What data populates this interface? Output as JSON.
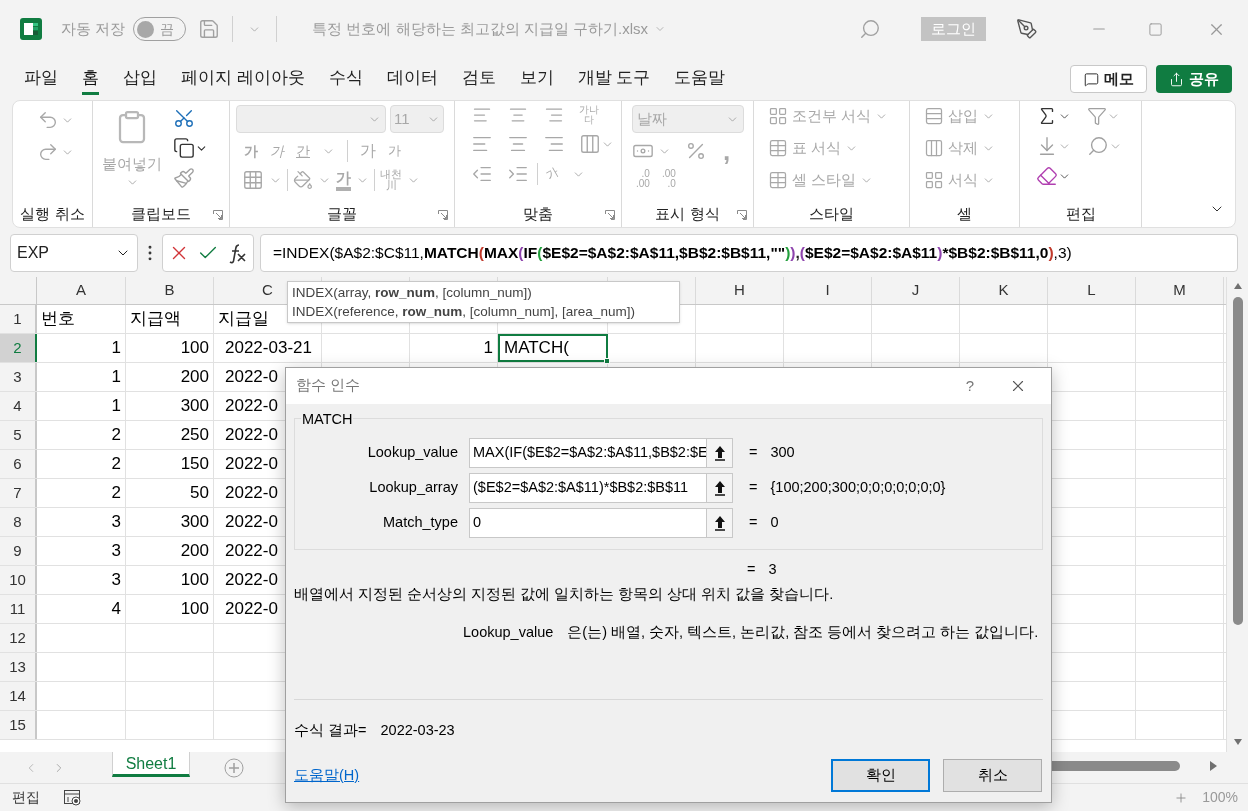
{
  "title_bar": {
    "autosave_label": "자동 저장",
    "autosave": {
      "on": false,
      "label": "끔"
    },
    "filename": "특정 번호에 해당하는 최고값의 지급일 구하기.xlsx",
    "login": "로그인"
  },
  "menu": {
    "tabs": [
      {
        "label": "파일",
        "selected": false
      },
      {
        "label": "홈",
        "selected": true
      },
      {
        "label": "삽입",
        "selected": false
      },
      {
        "label": "페이지 레이아웃",
        "selected": false
      },
      {
        "label": "수식",
        "selected": false
      },
      {
        "label": "데이터",
        "selected": false
      },
      {
        "label": "검토",
        "selected": false
      },
      {
        "label": "보기",
        "selected": false
      },
      {
        "label": "개발 도구",
        "selected": false
      },
      {
        "label": "도움말",
        "selected": false
      }
    ],
    "memo": "메모",
    "share": "공유"
  },
  "ribbon": {
    "disabled": true,
    "groups": [
      {
        "kind": "undo",
        "label": "실행 취소",
        "launcher": false
      },
      {
        "kind": "clipboard",
        "label": "클립보드",
        "launcher": true,
        "paste": "붙여넣기"
      },
      {
        "kind": "font",
        "label": "글꼴",
        "launcher": true,
        "font_size": "11",
        "bold": "가",
        "italic": "가",
        "underline": "간",
        "grow": "가",
        "shrink": "가",
        "font_color": "가",
        "phonetic": [
          "내천",
          "川"
        ]
      },
      {
        "kind": "alignment",
        "label": "맞춤",
        "launcher": true,
        "wrap": [
          "가나",
          "다"
        ],
        "orientation": "가"
      },
      {
        "kind": "number",
        "label": "표시 형식",
        "launcher": true,
        "format": "날짜",
        "comma": ",",
        "decimals": [
          [
            ".0",
            ".00"
          ],
          [
            ".00",
            ".0"
          ]
        ]
      },
      {
        "kind": "styles",
        "label": "스타일",
        "launcher": false,
        "items": [
          "조건부 서식",
          "표 서식",
          "셀 스타일"
        ]
      },
      {
        "kind": "cells",
        "label": "셀",
        "launcher": false,
        "items": [
          "삽입",
          "삭제",
          "서식"
        ]
      },
      {
        "kind": "editing",
        "label": "편집",
        "launcher": false
      }
    ]
  },
  "formula_bar": {
    "name_box": "EXP",
    "segments": [
      {
        "text": "=INDEX($A$2:$C$11,",
        "bold": false,
        "color": "#000000"
      },
      {
        "text": "MATCH",
        "bold": true,
        "color": "#000000"
      },
      {
        "text": "(",
        "bold": true,
        "color": "#c0392b"
      },
      {
        "text": "MAX",
        "bold": true,
        "color": "#000000"
      },
      {
        "text": "(",
        "bold": true,
        "color": "#8e44ad"
      },
      {
        "text": "IF",
        "bold": true,
        "color": "#000000"
      },
      {
        "text": "(",
        "bold": true,
        "color": "#22a03c"
      },
      {
        "text": "$E$2=$A$2:$A$11,$B$2:$B$11,\"\"",
        "bold": true,
        "color": "#000000"
      },
      {
        "text": ")",
        "bold": true,
        "color": "#22a03c"
      },
      {
        "text": ")",
        "bold": true,
        "color": "#8e44ad"
      },
      {
        "text": ",",
        "bold": true
      },
      {
        "text": "(",
        "bold": true,
        "color": "#8e44ad"
      },
      {
        "text": "$E$2=$A$2:$A$11",
        "bold": true,
        "color": "#000000"
      },
      {
        "text": ")",
        "bold": true,
        "color": "#8e44ad"
      },
      {
        "text": "*$B$2:$B$11,0",
        "bold": true,
        "color": "#000000"
      },
      {
        "text": ")",
        "bold": true,
        "color": "#c0392b"
      },
      {
        "text": ",3)",
        "bold": false,
        "color": "#000000"
      }
    ]
  },
  "tooltip": {
    "lines": [
      "INDEX(array, **row_num**, [column_num])",
      "INDEX(reference, **row_num**, [column_num], [area_num])"
    ]
  },
  "column_headers": [
    {
      "kind": "letter",
      "label": "A"
    },
    {
      "kind": "letter",
      "label": "B"
    },
    {
      "kind": "letter",
      "label": "C"
    },
    {
      "kind": "covered"
    },
    {
      "kind": "covered"
    },
    {
      "kind": "covered"
    },
    {
      "kind": "covered"
    },
    {
      "kind": "letter",
      "label": "H"
    },
    {
      "kind": "letter",
      "label": "I"
    },
    {
      "kind": "letter",
      "label": "J"
    },
    {
      "kind": "letter",
      "label": "K"
    },
    {
      "kind": "letter",
      "label": "L"
    },
    {
      "kind": "letter",
      "label": "M"
    }
  ],
  "sheet": {
    "rows": [
      {
        "header": "1",
        "selected": false,
        "cells": [
          {
            "text": "번호",
            "kind": "text",
            "selected": false
          },
          {
            "text": "지급액",
            "kind": "text",
            "selected": false
          },
          {
            "text": "지급일",
            "kind": "text",
            "selected": false
          }
        ]
      },
      {
        "header": "2",
        "selected": true,
        "cells": [
          {
            "text": "1",
            "kind": "number",
            "selected": false
          },
          {
            "text": "100",
            "kind": "number",
            "selected": false
          },
          {
            "text": "2022-03-21",
            "kind": "date",
            "selected": false
          },
          {
            "kind": "empty",
            "selected": false
          },
          {
            "text": "1",
            "kind": "number",
            "selected": false
          },
          {
            "text": "MATCH(",
            "kind": "text",
            "selected": true
          }
        ]
      },
      {
        "header": "3",
        "selected": false,
        "cells": [
          {
            "text": "1",
            "kind": "number",
            "selected": false
          },
          {
            "text": "200",
            "kind": "number",
            "selected": false
          },
          {
            "text": "2022-0",
            "kind": "date",
            "selected": false
          }
        ]
      },
      {
        "header": "4",
        "selected": false,
        "cells": [
          {
            "text": "1",
            "kind": "number",
            "selected": false
          },
          {
            "text": "300",
            "kind": "number",
            "selected": false
          },
          {
            "text": "2022-0",
            "kind": "date",
            "selected": false
          }
        ]
      },
      {
        "header": "5",
        "selected": false,
        "cells": [
          {
            "text": "2",
            "kind": "number",
            "selected": false
          },
          {
            "text": "250",
            "kind": "number",
            "selected": false
          },
          {
            "text": "2022-0",
            "kind": "date",
            "selected": false
          }
        ]
      },
      {
        "header": "6",
        "selected": false,
        "cells": [
          {
            "text": "2",
            "kind": "number",
            "selected": false
          },
          {
            "text": "150",
            "kind": "number",
            "selected": false
          },
          {
            "text": "2022-0",
            "kind": "date",
            "selected": false
          }
        ]
      },
      {
        "header": "7",
        "selected": false,
        "cells": [
          {
            "text": "2",
            "kind": "number",
            "selected": false
          },
          {
            "text": "50",
            "kind": "number",
            "selected": false
          },
          {
            "text": "2022-0",
            "kind": "date",
            "selected": false
          }
        ]
      },
      {
        "header": "8",
        "selected": false,
        "cells": [
          {
            "text": "3",
            "kind": "number",
            "selected": false
          },
          {
            "text": "300",
            "kind": "number",
            "selected": false
          },
          {
            "text": "2022-0",
            "kind": "date",
            "selected": false
          }
        ]
      },
      {
        "header": "9",
        "selected": false,
        "cells": [
          {
            "text": "3",
            "kind": "number",
            "selected": false
          },
          {
            "text": "200",
            "kind": "number",
            "selected": false
          },
          {
            "text": "2022-0",
            "kind": "date",
            "selected": false
          }
        ]
      },
      {
        "header": "10",
        "selected": false,
        "cells": [
          {
            "text": "3",
            "kind": "number",
            "selected": false
          },
          {
            "text": "100",
            "kind": "number",
            "selected": false
          },
          {
            "text": "2022-0",
            "kind": "date",
            "selected": false
          }
        ]
      },
      {
        "header": "11",
        "selected": false,
        "cells": [
          {
            "text": "4",
            "kind": "number",
            "selected": false
          },
          {
            "text": "100",
            "kind": "number",
            "selected": false
          },
          {
            "text": "2022-0",
            "kind": "date",
            "selected": false
          }
        ]
      },
      {
        "header": "12",
        "selected": false,
        "cells": []
      },
      {
        "header": "13",
        "selected": false,
        "cells": []
      },
      {
        "header": "14",
        "selected": false,
        "cells": []
      },
      {
        "header": "15",
        "selected": false,
        "cells": []
      }
    ]
  },
  "sheet_tabs": [
    {
      "label": "Sheet1",
      "selected": true
    }
  ],
  "status_bar": {
    "mode": "편집",
    "zoom": "100%"
  },
  "dialog": {
    "title": "함수 인수",
    "help_glyph": "?",
    "function": "MATCH",
    "args": [
      {
        "label": "Lookup_value",
        "value": "MAX(IF($E$2=$A$2:$A$11,$B$2:$E",
        "result": "300"
      },
      {
        "label": "Lookup_array",
        "value": "($E$2=$A$2:$A$11)*$B$2:$B$11",
        "result": "{100;200;300;0;0;0;0;0;0;0}"
      },
      {
        "label": "Match_type",
        "value": "0",
        "result": "0"
      }
    ],
    "equals": "=",
    "total": "3",
    "description": "배열에서 지정된 순서상의 지정된 값에 일치하는 항목의 상대 위치 값을 찾습니다.",
    "arg_name": "Lookup_value",
    "arg_help": "은(는) 배열, 숫자, 텍스트, 논리값, 참조 등에서 찾으려고 하는 값입니다.",
    "result_label": "수식 결과=",
    "result": "2022-03-23",
    "help_link": "도움말(H)",
    "buttons": [
      {
        "label": "확인",
        "default": true
      },
      {
        "label": "취소",
        "default": false
      }
    ]
  }
}
